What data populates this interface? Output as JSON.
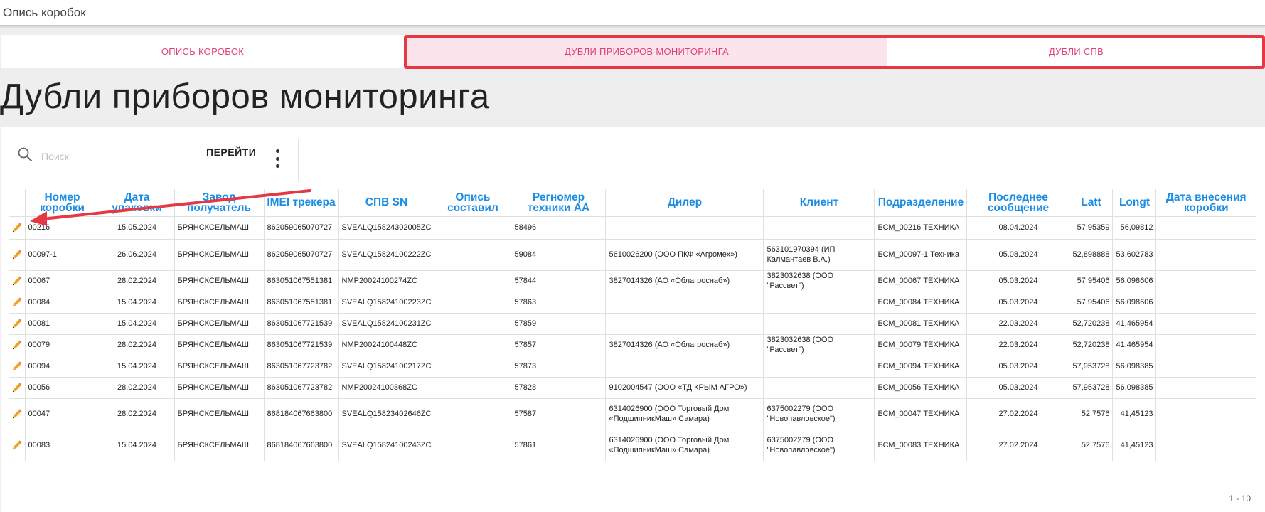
{
  "window": {
    "title": "Опись коробок"
  },
  "tabs": [
    {
      "label": "ОПИСЬ КОРОБОК"
    },
    {
      "label": "ДУБЛИ ПРИБОРОВ МОНИТОРИНГА"
    },
    {
      "label": "ДУБЛИ СПВ"
    }
  ],
  "page": {
    "title": "Дубли приборов мониторинга"
  },
  "toolbar": {
    "search_placeholder": "Поиск",
    "search_value": "",
    "go_label": "ПЕРЕЙТИ"
  },
  "table": {
    "columns": [
      "",
      "Номер коробки",
      "Дата упаковки",
      "Завод получатель",
      "IMEI трекера",
      "СПВ SN",
      "Опись составил",
      "Регномер техники АА",
      "Дилер",
      "Клиент",
      "Подразделение",
      "Последнее сообщение",
      "Latt",
      "Longt",
      "Дата внесения коробки"
    ],
    "rows": [
      [
        "",
        "00216",
        "15.05.2024",
        "БРЯНСКСЕЛЬМАШ",
        "862059065070727",
        "SVEALQ15824302005ZC",
        "",
        "58496",
        "",
        "",
        "БСМ_00216 ТЕХНИКА",
        "08.04.2024",
        "57,95359",
        "56,09812",
        ""
      ],
      [
        "",
        "00097-1",
        "26.06.2024",
        "БРЯНСКСЕЛЬМАШ",
        "862059065070727",
        "SVEALQ15824100222ZC",
        "",
        "59084",
        "5610026200 (ООО ПКФ «Агромех»)",
        "563101970394 (ИП Калмантаев В.А.)",
        "БСМ_00097-1 Техника",
        "05.08.2024",
        "52,898888",
        "53,602783",
        ""
      ],
      [
        "",
        "00067",
        "28.02.2024",
        "БРЯНСКСЕЛЬМАШ",
        "863051067551381",
        "NMP20024100274ZC",
        "",
        "57844",
        "3827014326 (АО «Облагроснаб»)",
        "3823032638 (ООО \"Рассвет\")",
        "БСМ_00067 ТЕХНИКА",
        "05.03.2024",
        "57,95406",
        "56,098606",
        ""
      ],
      [
        "",
        "00084",
        "15.04.2024",
        "БРЯНСКСЕЛЬМАШ",
        "863051067551381",
        "SVEALQ15824100223ZC",
        "",
        "57863",
        "",
        "",
        "БСМ_00084 ТЕХНИКА",
        "05.03.2024",
        "57,95406",
        "56,098606",
        ""
      ],
      [
        "",
        "00081",
        "15.04.2024",
        "БРЯНСКСЕЛЬМАШ",
        "863051067721539",
        "SVEALQ15824100231ZC",
        "",
        "57859",
        "",
        "",
        "БСМ_00081 ТЕХНИКА",
        "22.03.2024",
        "52,720238",
        "41,465954",
        ""
      ],
      [
        "",
        "00079",
        "28.02.2024",
        "БРЯНСКСЕЛЬМАШ",
        "863051067721539",
        "NMP20024100448ZC",
        "",
        "57857",
        "3827014326 (АО «Облагроснаб»)",
        "3823032638 (ООО \"Рассвет\")",
        "БСМ_00079 ТЕХНИКА",
        "22.03.2024",
        "52,720238",
        "41,465954",
        ""
      ],
      [
        "",
        "00094",
        "15.04.2024",
        "БРЯНСКСЕЛЬМАШ",
        "863051067723782",
        "SVEALQ15824100217ZC",
        "",
        "57873",
        "",
        "",
        "БСМ_00094 ТЕХНИКА",
        "05.03.2024",
        "57,953728",
        "56,098385",
        ""
      ],
      [
        "",
        "00056",
        "28.02.2024",
        "БРЯНСКСЕЛЬМАШ",
        "863051067723782",
        "NMP20024100368ZC",
        "",
        "57828",
        "9102004547 (ООО «ТД КРЫМ АГРО»)",
        "",
        "БСМ_00056 ТЕХНИКА",
        "05.03.2024",
        "57,953728",
        "56,098385",
        ""
      ],
      [
        "",
        "00047",
        "28.02.2024",
        "БРЯНСКСЕЛЬМАШ",
        "868184067663800",
        "SVEALQ15823402646ZC",
        "",
        "57587",
        "6314026900 (ООО Торговый Дом «ПодшипникМаш» Самара)",
        "6375002279 (ООО \"Новопавловское\")",
        "БСМ_00047 ТЕХНИКА",
        "27.02.2024",
        "52,7576",
        "41,45123",
        ""
      ],
      [
        "",
        "00083",
        "15.04.2024",
        "БРЯНСКСЕЛЬМАШ",
        "868184067663800",
        "SVEALQ15824100243ZC",
        "",
        "57861",
        "6314026900 (ООО Торговый Дом «ПодшипникМаш» Самара)",
        "6375002279 (ООО \"Новопавловское\")",
        "БСМ_00083 ТЕХНИКА",
        "27.02.2024",
        "52,7576",
        "41,45123",
        ""
      ]
    ]
  },
  "pagination": {
    "range": "1 - 10"
  },
  "icons": {
    "search": "search-icon",
    "edit": "pencil-icon",
    "more": "more-vertical-icon"
  },
  "colors": {
    "accent": "#1a8ee6",
    "tab_text": "#e0407a",
    "tab_active_bg": "#fce4ec",
    "highlight": "#e53844",
    "pencil": "#f2a51a"
  }
}
